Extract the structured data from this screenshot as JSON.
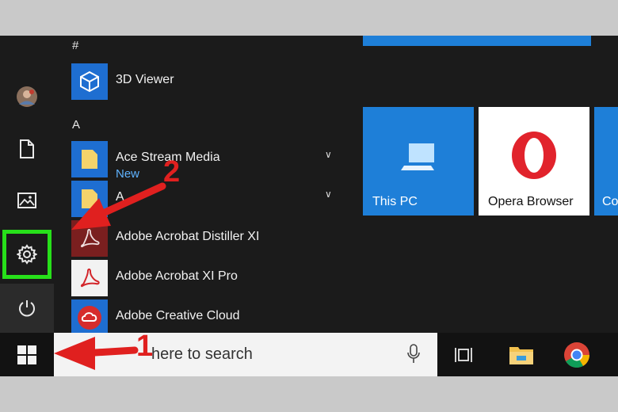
{
  "start_menu": {
    "rail": {
      "items": [
        {
          "name": "user-avatar",
          "icon": "avatar"
        },
        {
          "name": "documents",
          "icon": "document-icon"
        },
        {
          "name": "pictures",
          "icon": "pictures-icon"
        },
        {
          "name": "settings",
          "icon": "gear-icon",
          "highlight_color": "#27e01a"
        },
        {
          "name": "power",
          "icon": "power-icon"
        }
      ]
    },
    "app_list": {
      "group_hash": "#",
      "group_a": "A",
      "apps": [
        {
          "label": "3D Viewer",
          "icon": "cube-icon"
        },
        {
          "label": "Ace Stream Media",
          "sublabel": "New",
          "icon": "folder-icon",
          "expandable": true
        },
        {
          "label": "A",
          "icon": "folder-icon",
          "expandable": true
        },
        {
          "label": "Adobe Acrobat Distiller XI",
          "icon": "acrobat-icon"
        },
        {
          "label": "Adobe Acrobat XI Pro",
          "icon": "acrobat-icon"
        },
        {
          "label": "Adobe Creative Cloud",
          "icon": "creative-cloud-icon"
        }
      ]
    },
    "tiles": [
      {
        "label": "This PC",
        "icon": "computer-icon",
        "color": "#1e7fd8"
      },
      {
        "label": "Opera Browser",
        "icon": "opera-icon",
        "color": "#ffffff"
      },
      {
        "label": "Co",
        "color": "#1e7fd8"
      }
    ]
  },
  "taskbar": {
    "start_icon": "windows-icon",
    "search_placeholder": "Type here to search",
    "search_visible_text": "here to search",
    "icons": [
      "microphone-icon",
      "task-view-icon",
      "file-explorer-icon",
      "chrome-icon"
    ]
  },
  "annotations": {
    "arrow_1_label": "1",
    "arrow_2_label": "2",
    "arrow_color": "#e0201f"
  }
}
